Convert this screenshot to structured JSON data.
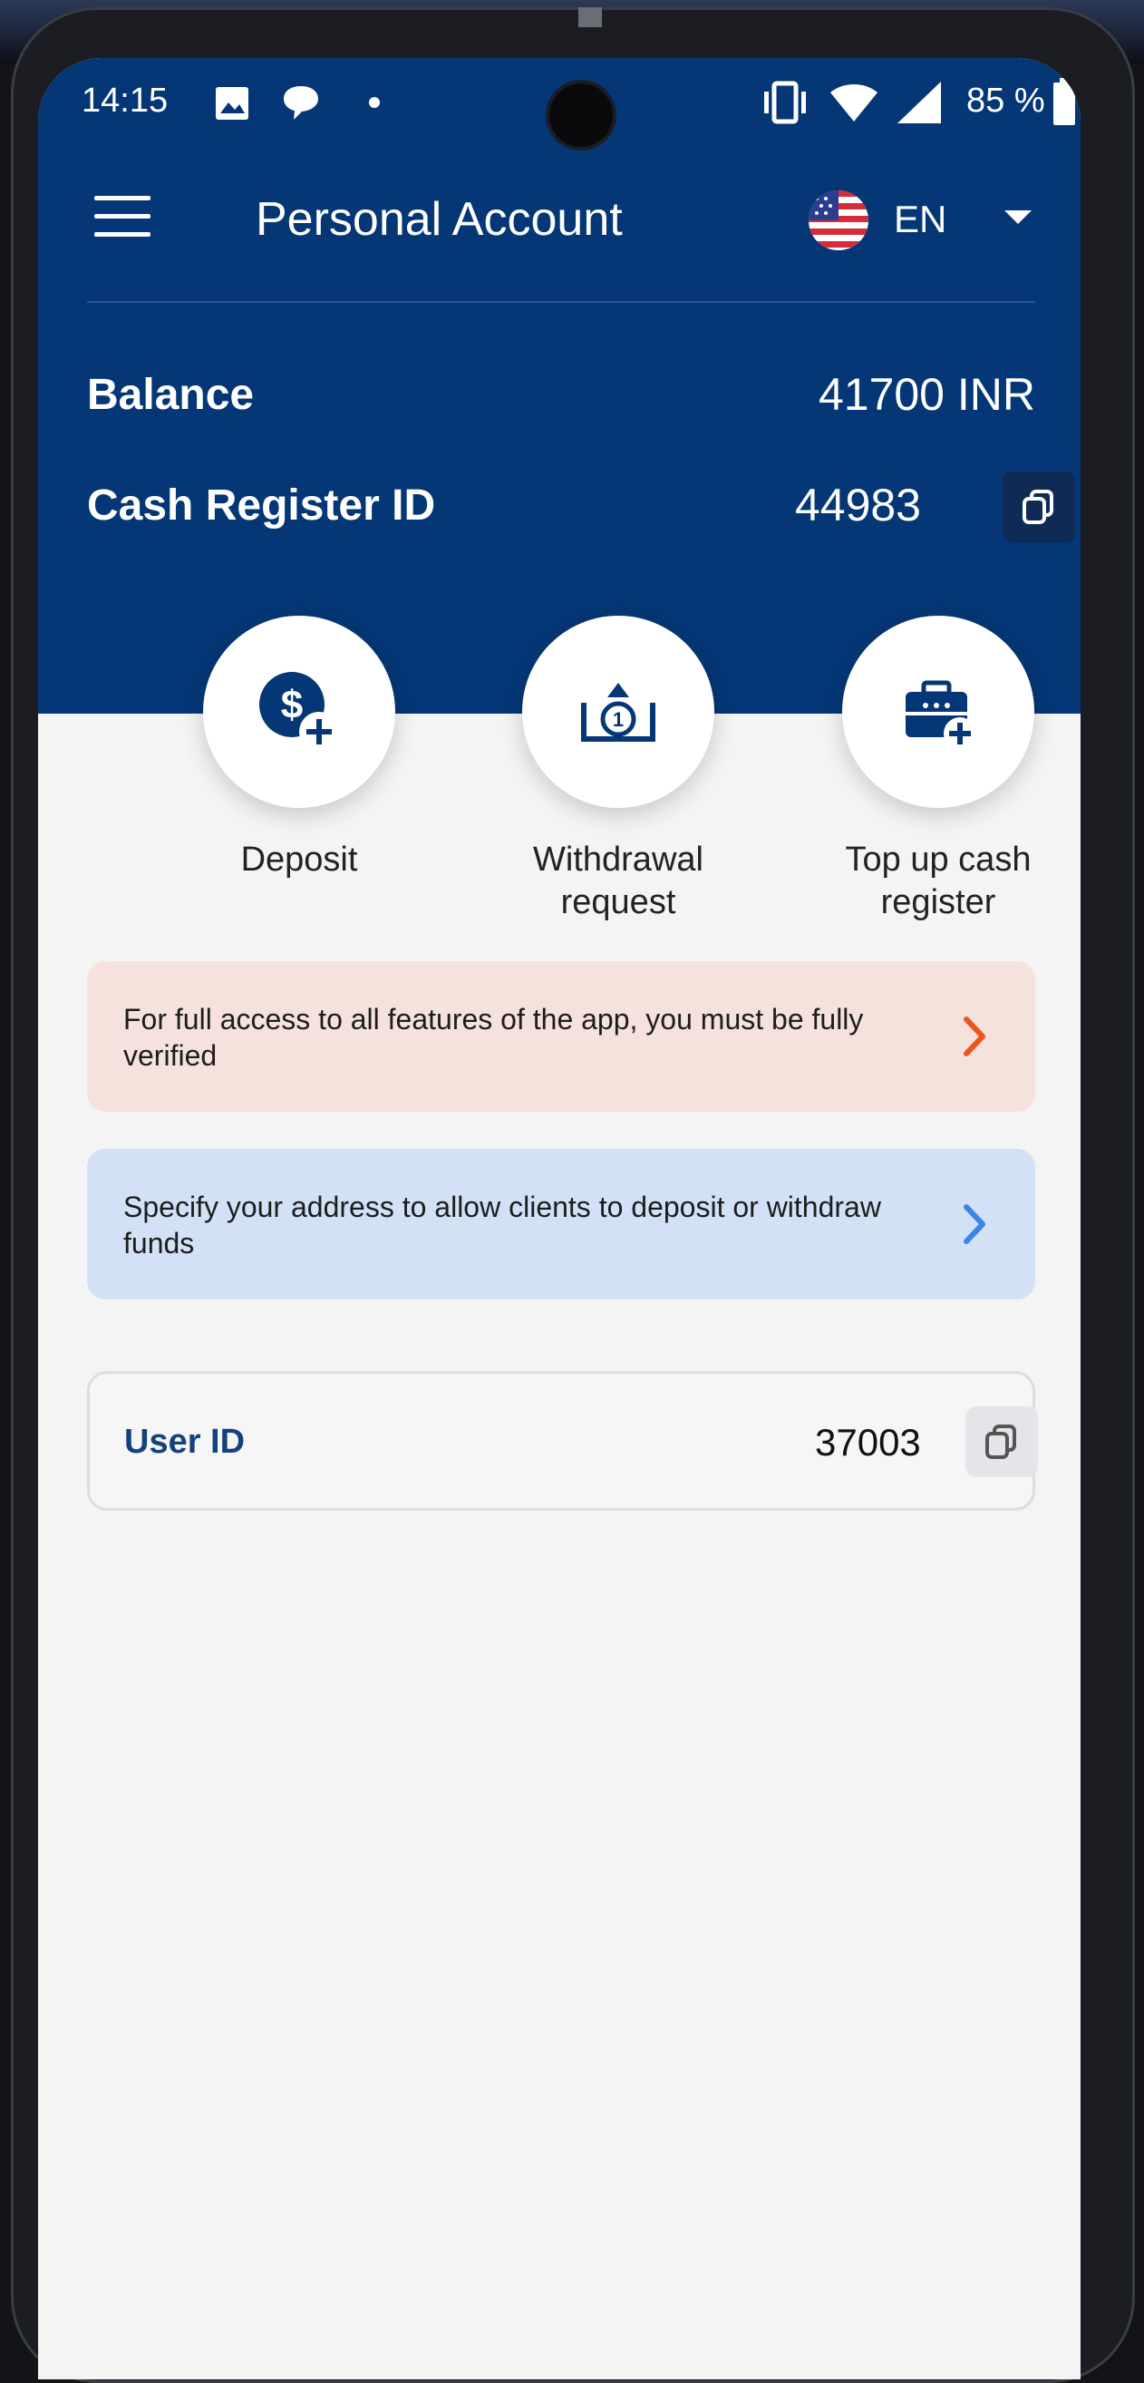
{
  "status_bar": {
    "time": "14:15",
    "battery": "85 %",
    "icons": [
      "image-icon",
      "chat-bubble-icon",
      "dot-icon",
      "vibrate-icon",
      "wifi-icon",
      "signal-icon",
      "battery-icon"
    ]
  },
  "app_bar": {
    "title": "Personal Account",
    "language": "EN",
    "icons": [
      "menu-icon",
      "us-flag-icon",
      "caret-down-icon"
    ]
  },
  "account": {
    "balance_label": "Balance",
    "balance_value": "41700 INR",
    "cash_register_label": "Cash Register ID",
    "cash_register_value": "44983"
  },
  "actions": [
    {
      "label": "Deposit",
      "icon": "dollar-plus-icon"
    },
    {
      "label": "Withdrawal\nrequest",
      "icon": "withdraw-tray-icon"
    },
    {
      "label": "Top up cash\nregister",
      "icon": "briefcase-plus-icon"
    }
  ],
  "notices": [
    {
      "text": "For full access to all features of the app, you must be fully verified",
      "icon": "chevron-right-icon"
    },
    {
      "text": "Specify your address to allow clients to deposit or withdraw funds",
      "icon": "chevron-right-icon"
    }
  ],
  "user": {
    "label": "User ID",
    "value": "37003"
  },
  "colors": {
    "header": "#053776",
    "background": "#f4f4f5",
    "verify_notice_bg": "#f6e2dc",
    "verify_arrow": "#f0531f",
    "address_notice_bg": "#d2e1f6",
    "address_arrow": "#3a86e8",
    "user_label": "#15427d"
  }
}
